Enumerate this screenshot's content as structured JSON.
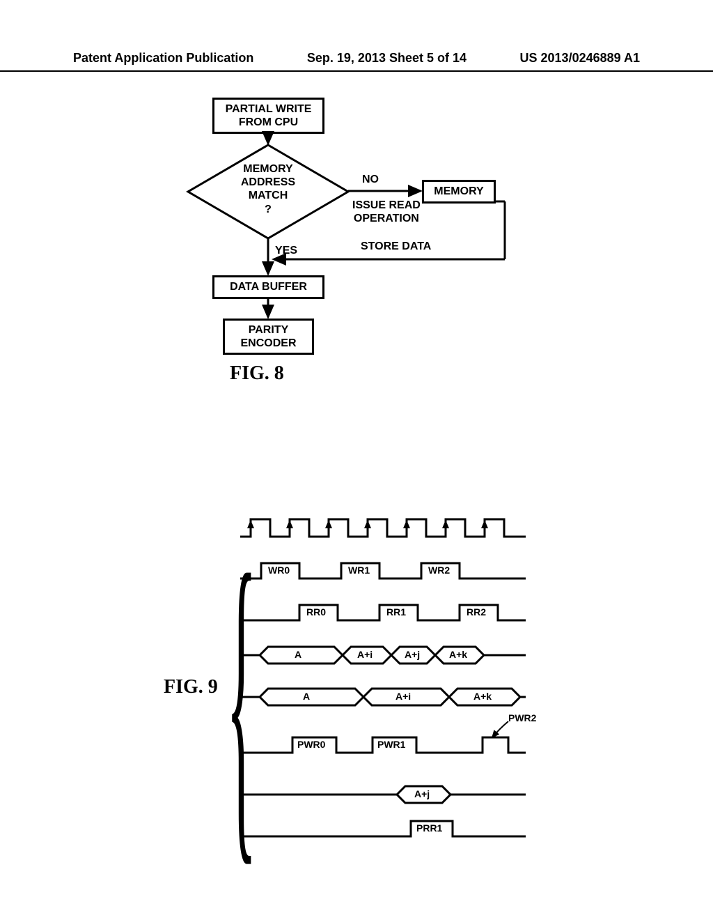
{
  "header": {
    "left": "Patent Application Publication",
    "center": "Sep. 19, 2013  Sheet 5 of 14",
    "right": "US 2013/0246889 A1"
  },
  "fig8": {
    "box_partial_write": "PARTIAL WRITE\nFROM CPU",
    "diamond_text": "MEMORY\nADDRESS MATCH\n?",
    "no_label": "NO",
    "issue_read": "ISSUE READ\nOPERATION",
    "memory_box": "MEMORY",
    "store_data": "STORE DATA",
    "yes_label": "YES",
    "data_buffer": "DATA BUFFER",
    "parity_encoder": "PARITY\nENCODER",
    "caption": "FIG. 8"
  },
  "fig9": {
    "caption": "FIG. 9",
    "wr0": "WR0",
    "wr1": "WR1",
    "wr2": "WR2",
    "rr0": "RR0",
    "rr1": "RR1",
    "rr2": "RR2",
    "a": "A",
    "ai": "A+i",
    "aj": "A+j",
    "ak": "A+k",
    "pwr0": "PWR0",
    "pwr1": "PWR1",
    "pwr2": "PWR2",
    "prr1": "PRR1"
  }
}
